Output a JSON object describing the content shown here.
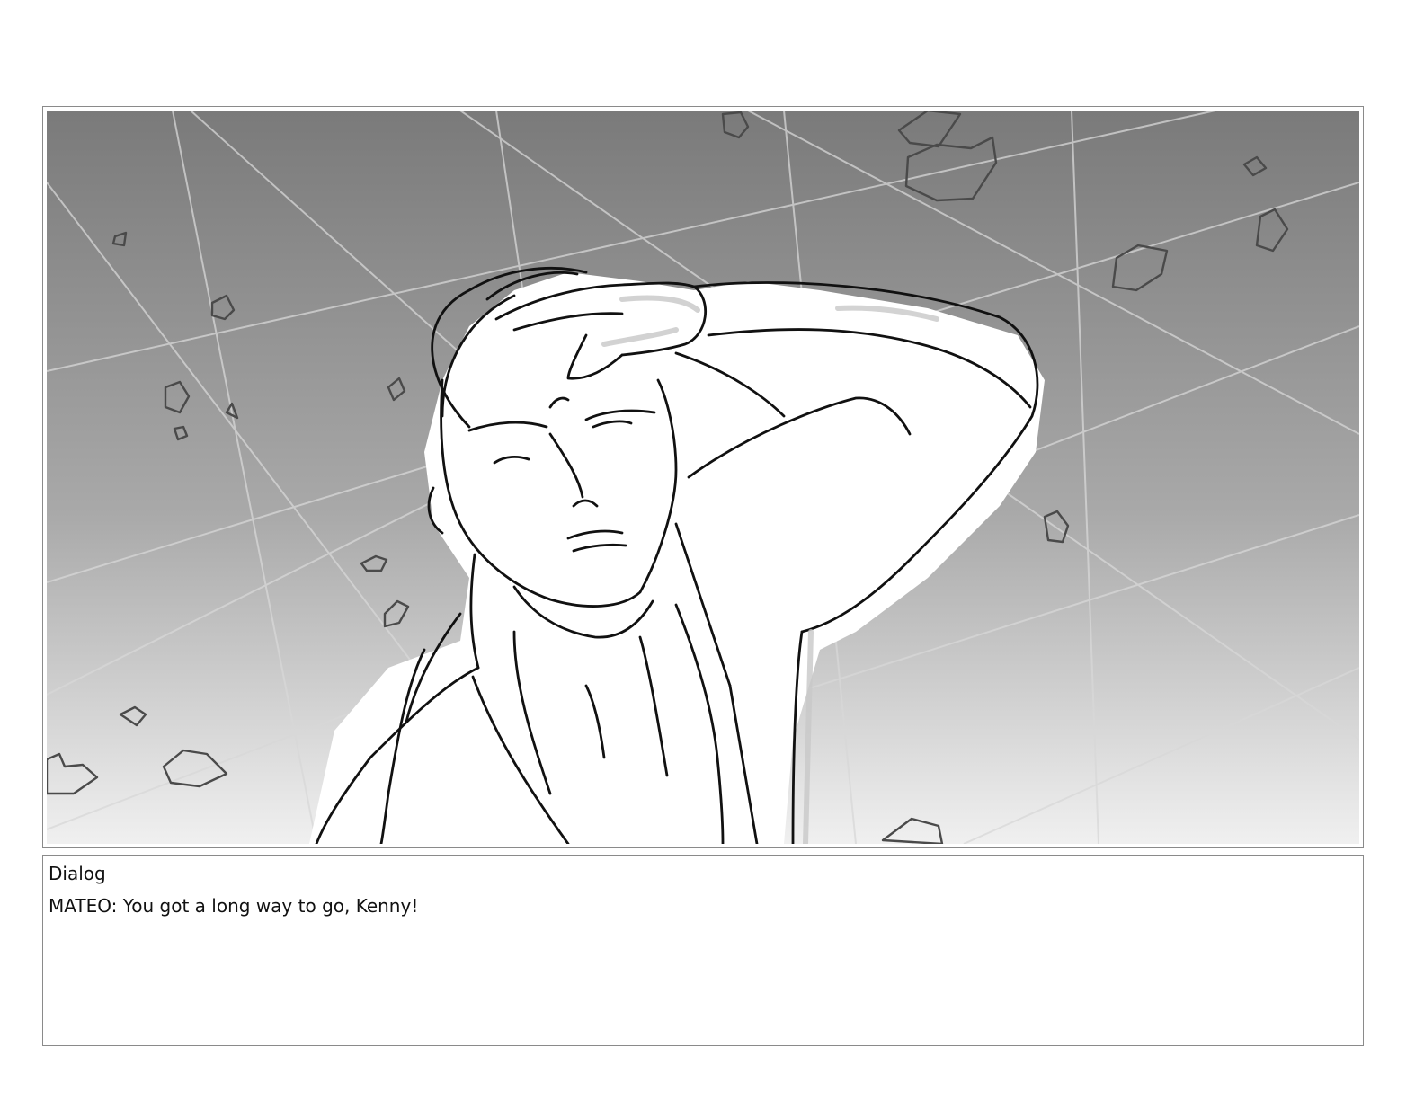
{
  "panel": {
    "illustration": "storyboard-sketch-man-shielding-eyes"
  },
  "dialog": {
    "label": "Dialog",
    "line": "MATEO: You got a long way to go, Kenny!"
  },
  "colors": {
    "frame_border": "#8a8a8a",
    "sky_top": "#7a7a7a",
    "sky_bottom": "#f0f0f0",
    "ink": "#111111",
    "grid_line": "#d6d6d6",
    "debris_ink": "#4a4a4a"
  }
}
